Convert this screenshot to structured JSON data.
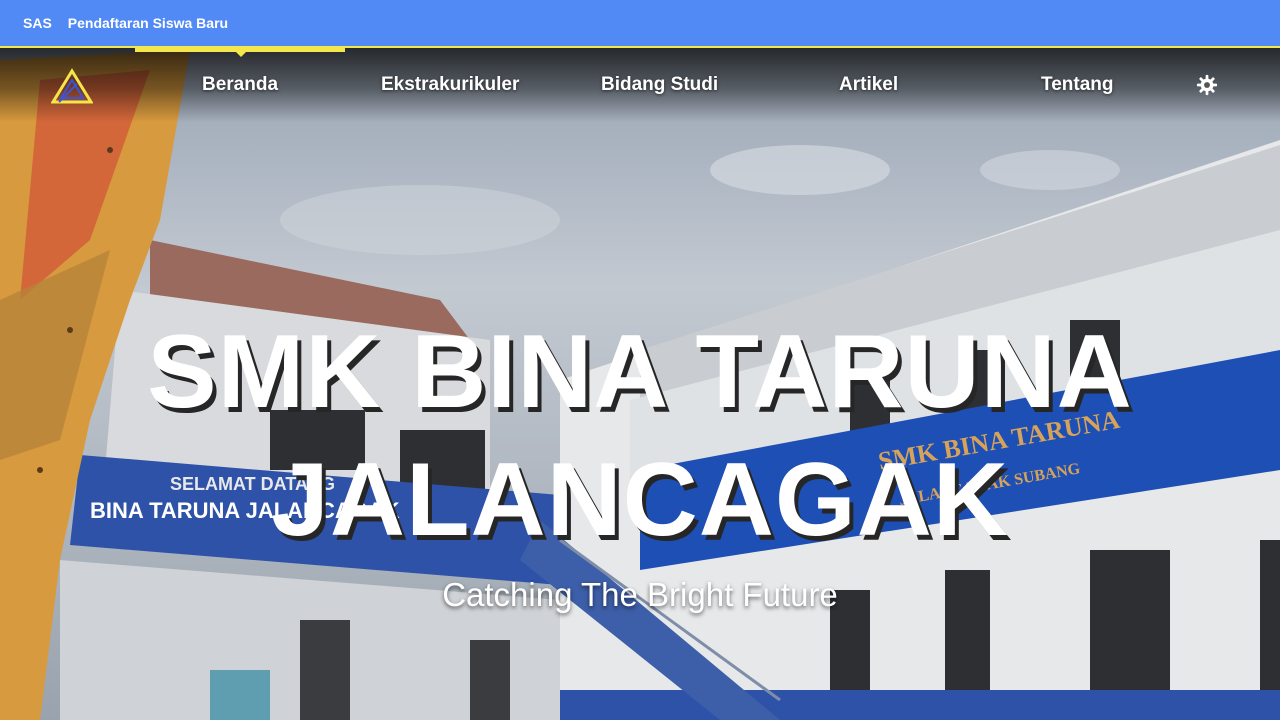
{
  "topbar": {
    "links": [
      "SAS",
      "Pendaftaran Siswa Baru"
    ]
  },
  "nav": {
    "items": [
      "Beranda",
      "Ekstrakurikuler",
      "Bidang Studi",
      "Artikel",
      "Tentang"
    ],
    "active": "Beranda",
    "settings_icon": "gear-icon",
    "logo_icon": "triangle-logo-icon"
  },
  "hero": {
    "title_line1": "SMK BINA TARUNA",
    "title_line2": "JALANCAGAK",
    "subtitle": "Catching The Bright Future",
    "building_sign": "SMK BINA TARUNA",
    "building_sign_sub": "JALANCAGAK SUBANG",
    "banner_text": "SELAMAT DATANG",
    "banner_text2": "BINA TARUNA JALANCAGAK"
  },
  "colors": {
    "topbar": "#5189f5",
    "accent": "#f4e64b",
    "text": "#ffffff"
  }
}
